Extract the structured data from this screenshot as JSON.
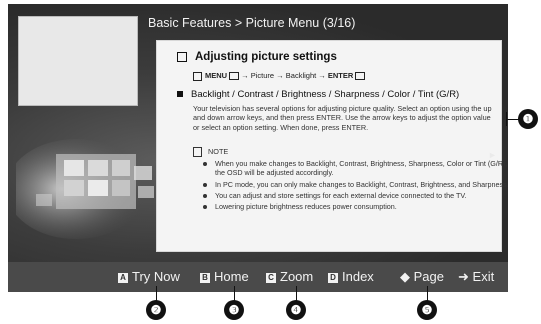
{
  "header": {
    "breadcrumb": "Basic Features > Picture Menu (3/16)"
  },
  "section": {
    "title": "Adjusting picture settings",
    "menu_path_prefix": "MENU",
    "menu_path_mid": " → Picture → Backlight → ",
    "menu_path_enter": "ENTER"
  },
  "item": {
    "title": "Backlight / Contrast / Brightness / Sharpness / Color / Tint (G/R)",
    "description": "Your television has several options for adjusting picture quality. Select an option using the up and down arrow keys, and then press ENTER. Use the arrow keys to adjust the option value or select an option setting. When done, press ENTER."
  },
  "note": {
    "label": "NOTE",
    "items": [
      "When you make changes to Backlight, Contrast, Brightness, Sharpness, Color or Tint (G/R), the OSD will be adjusted accordingly.",
      "In PC mode, you can only make changes to Backlight, Contrast, Brightness, and Sharpness.",
      "You can adjust and store settings for each external device connected to the TV.",
      "Lowering picture brightness reduces power consumption."
    ]
  },
  "nav": {
    "left": "◄",
    "right": "►"
  },
  "bottom_bar": {
    "try_now": {
      "key": "A",
      "label": "Try Now"
    },
    "home": {
      "key": "B",
      "label": "Home"
    },
    "zoom": {
      "key": "C",
      "label": "Zoom"
    },
    "index": {
      "key": "D",
      "label": "Index"
    },
    "page": {
      "icon": "◆",
      "label": "Page"
    },
    "exit": {
      "icon": "➜",
      "label": "Exit"
    }
  },
  "callouts": [
    "❶",
    "❷",
    "❸",
    "❹",
    "❺"
  ],
  "colors": {
    "screen_bg": "#2e2e2e",
    "panel_bg": "#f4f4f4",
    "bar_bg": "#4a4a4a",
    "callout": "#111111"
  }
}
